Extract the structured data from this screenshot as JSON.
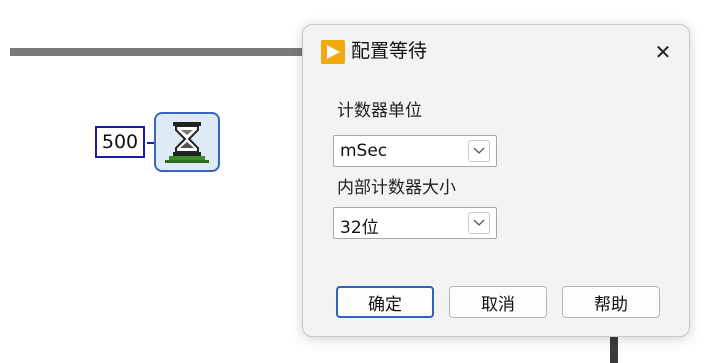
{
  "diagram": {
    "constant_value": "500"
  },
  "dialog": {
    "title": "配置等待",
    "close_glyph": "✕",
    "field1": {
      "label": "计数器单位",
      "value": "mSec",
      "icon": "chevron-down-icon"
    },
    "field2": {
      "label": "内部计数器大小",
      "value": "32位",
      "icon": "chevron-down-icon"
    },
    "buttons": {
      "ok": "确定",
      "cancel": "取消",
      "help": "帮助"
    }
  },
  "colors": {
    "wire_gray": "#7a7a7a",
    "constant_border": "#1a1aa8",
    "node_border": "#3a66b8",
    "default_button_border": "#2c63c0",
    "title_icon_bg": "#f2a90c"
  }
}
